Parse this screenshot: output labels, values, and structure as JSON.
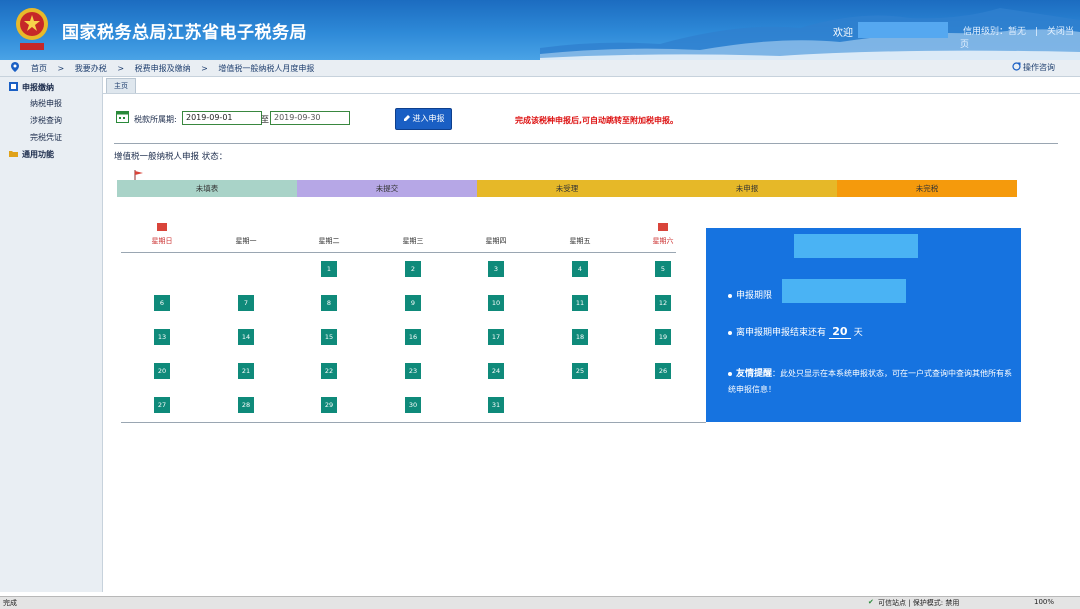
{
  "header": {
    "title": "国家税务总局江苏省电子税务局",
    "welcome": "欢迎",
    "links": [
      "信用级别：暂无",
      "|",
      "关闭当页"
    ]
  },
  "breadcrumb": {
    "items": [
      "首页",
      ">",
      "我要办税",
      ">",
      "税费申报及缴纳",
      ">",
      "增值税一般纳税人月度申报"
    ],
    "help": "操作咨询"
  },
  "sidebar": {
    "items": [
      {
        "label": "申报缴纳",
        "icon": "grid-icon"
      },
      {
        "label": "纳税申报"
      },
      {
        "label": "涉税查询"
      },
      {
        "label": "完税凭证"
      },
      {
        "label": "通用功能",
        "icon": "folder-icon"
      }
    ]
  },
  "tabs": {
    "home": "主页"
  },
  "period": {
    "label": "税款所属期:",
    "from": "2019-09-01",
    "to_label": "至",
    "to": "2019-09-30"
  },
  "enter_button": "进入申报",
  "notice": "完成该税种申报后,可自动跳转至附加税申报。",
  "status": {
    "title": "增值税一般纳税人申报 状态：",
    "steps": [
      {
        "label": "未填表",
        "color": "#a9d3c8"
      },
      {
        "label": "未提交",
        "color": "#b6a7e6"
      },
      {
        "label": "未受理",
        "color": "#e6b828"
      },
      {
        "label": "未申报",
        "color": "#e6b828"
      },
      {
        "label": "未完税",
        "color": "#f59a0c"
      }
    ]
  },
  "calendar": {
    "weekdays": [
      "星期日",
      "星期一",
      "星期二",
      "星期三",
      "星期四",
      "星期五",
      "星期六"
    ],
    "weeks": [
      [
        "",
        "",
        "1",
        "2",
        "3",
        "4",
        "5"
      ],
      [
        "6",
        "7",
        "8",
        "9",
        "10",
        "11",
        "12"
      ],
      [
        "13",
        "14",
        "15",
        "16",
        "17",
        "18",
        "19"
      ],
      [
        "20",
        "21",
        "22",
        "23",
        "24",
        "25",
        "26"
      ],
      [
        "27",
        "28",
        "29",
        "30",
        "31",
        "",
        ""
      ]
    ],
    "accent": "#0f8a7a"
  },
  "info": {
    "deadline_label": "申报期限",
    "remaining_prefix": "离申报期申报结束还有",
    "remaining_days": "20",
    "remaining_suffix": "天",
    "reminder_label": "友情提醒",
    "reminder_text": "：此处只显示在本系统申报状态，可在一户式查询中查询其他所有系统申报信息！"
  },
  "ie_status": {
    "left": "完成",
    "zone": "可信站点 | 保护模式: 禁用",
    "zoom": "100%"
  }
}
